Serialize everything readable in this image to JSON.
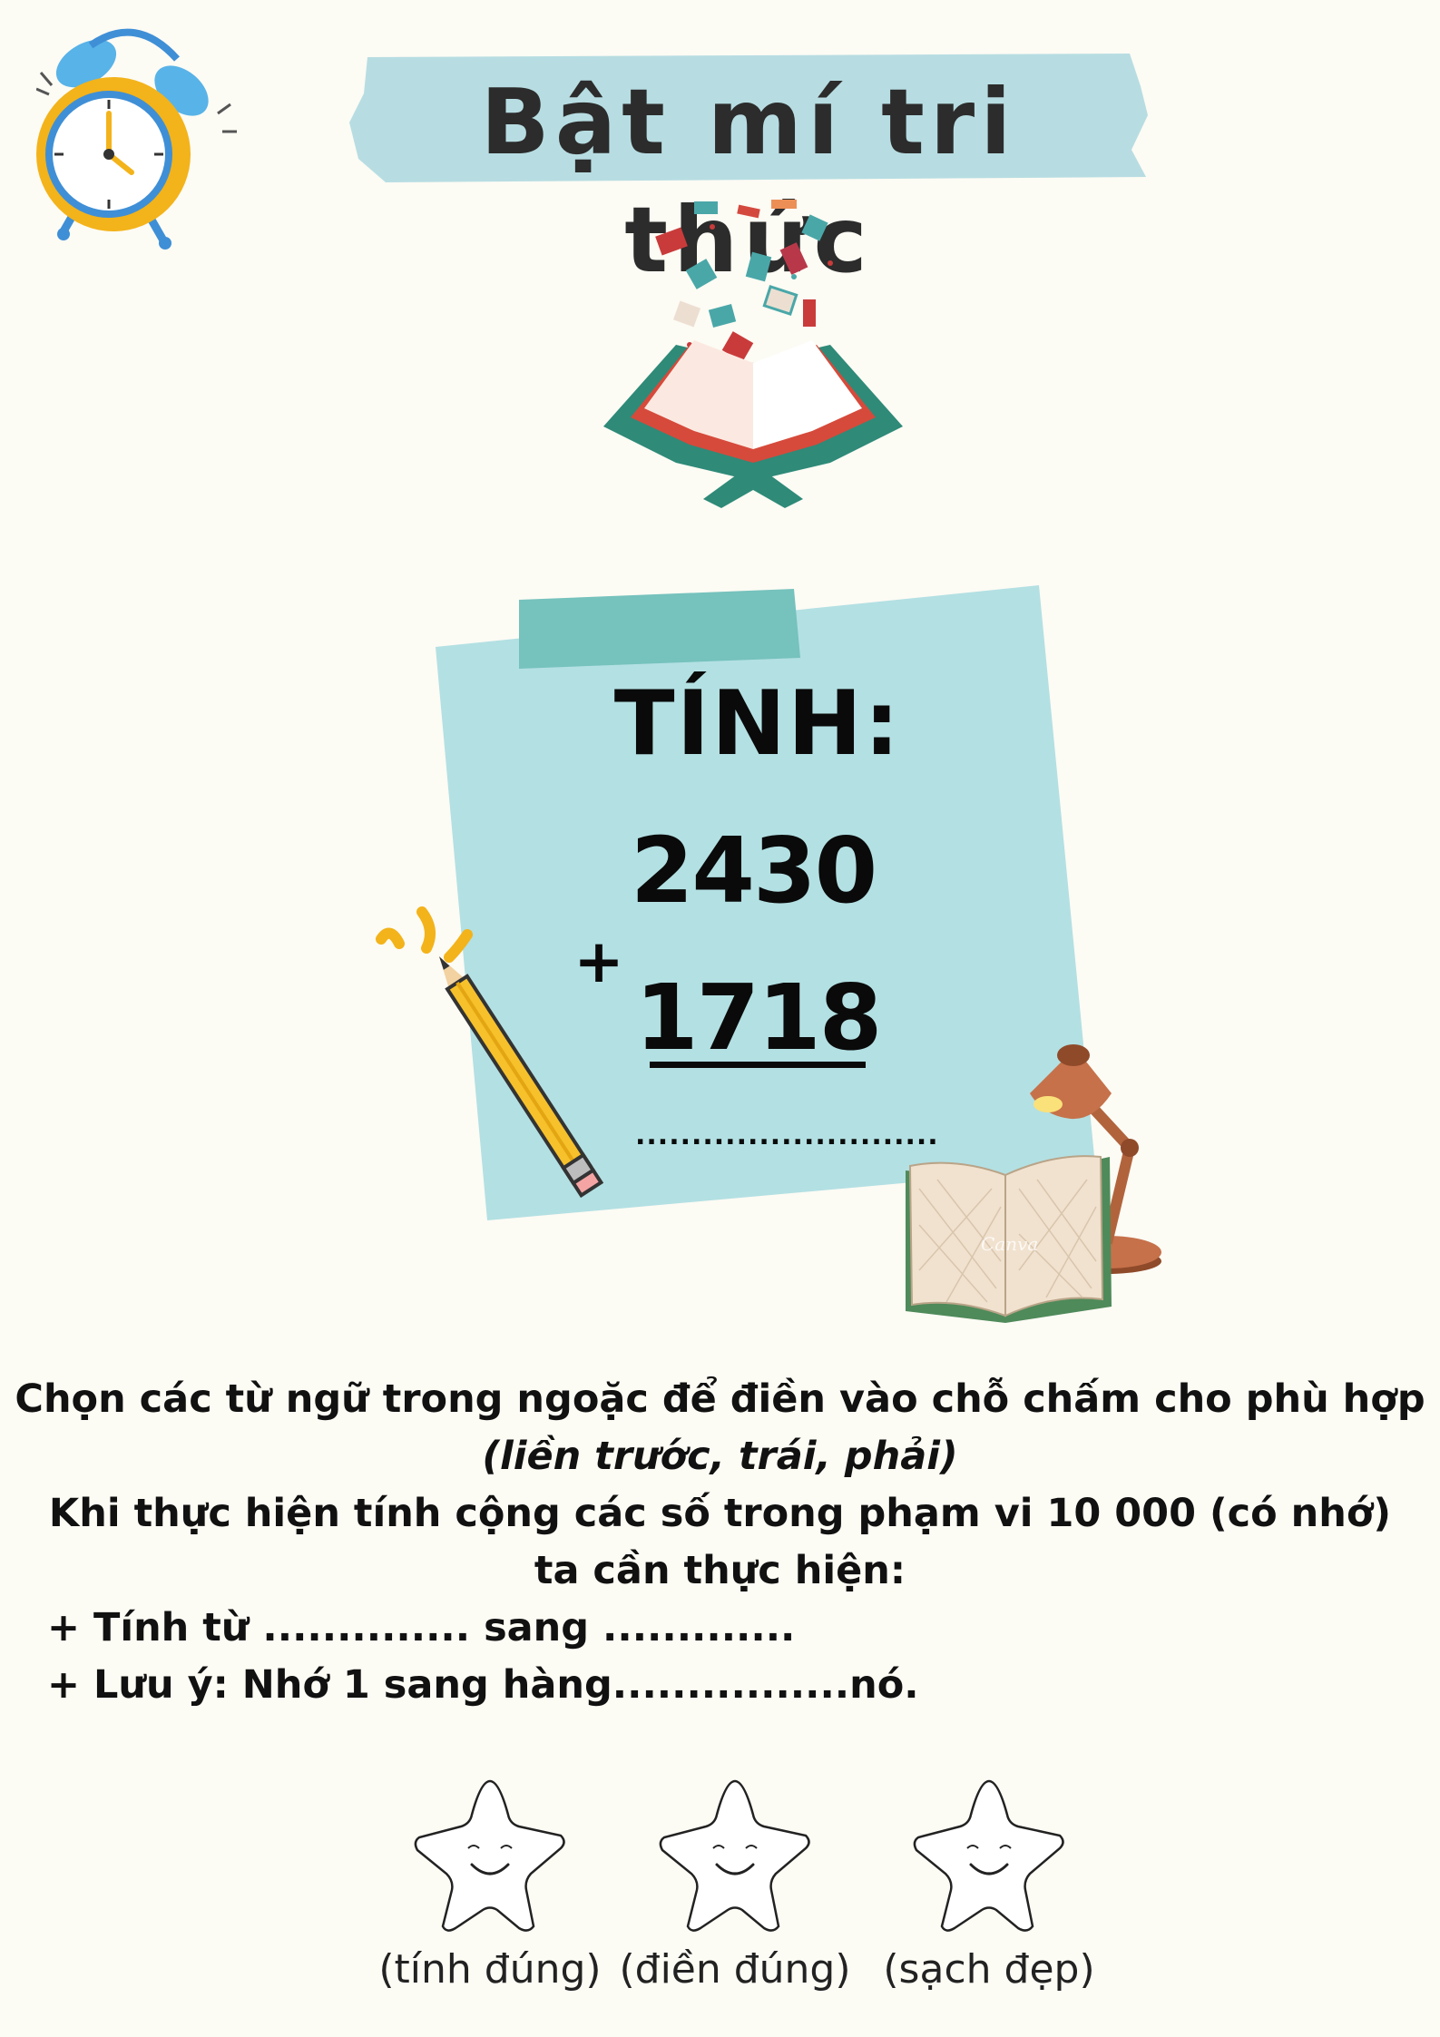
{
  "title": "Bật mí tri thức",
  "note": {
    "label": "TÍNH:",
    "number_1": "2430",
    "operator": "+",
    "number_2": "1718",
    "answer_blank": "..........................."
  },
  "text": {
    "instruction": "Chọn các từ ngữ trong ngoặc để điền vào chỗ chấm cho phù hợp",
    "options": "(liền trước, trái, phải)",
    "rule_line1": "Khi thực hiện tính cộng các số trong phạm vi 10 000 (có nhớ)",
    "rule_line2": "ta cần thực hiện:",
    "step1": "+ Tính từ .............. sang .............",
    "step2": "+ Lưu ý: Nhớ 1 sang hàng................nó."
  },
  "stars": [
    {
      "label": "(tính đúng)"
    },
    {
      "label": "(điền đúng)"
    },
    {
      "label": "(sạch đẹp)"
    }
  ],
  "decorations": {
    "clock_icon": "alarm-clock-icon",
    "book_icon": "open-book-flying-books-icon",
    "pencil_icon": "pencil-icon",
    "lamp_icon": "desk-lamp-icon",
    "notebook_icon": "open-notebook-icon",
    "book_watermark": "Canva"
  },
  "colors": {
    "background": "#fcfbf4",
    "banner": "#b7dde2",
    "sticky_note": "#b3e0e3",
    "tape": "#76c2bd"
  }
}
